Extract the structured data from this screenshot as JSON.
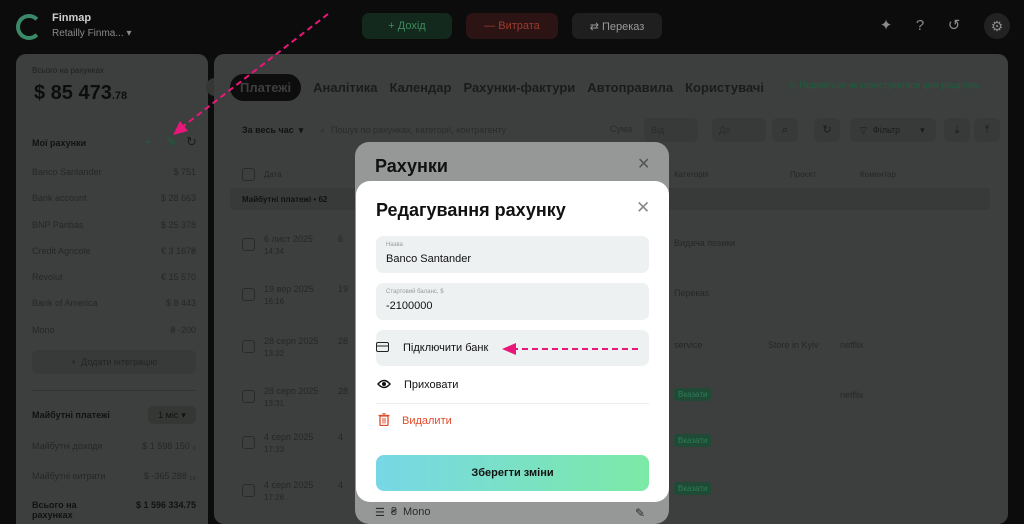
{
  "topbar": {
    "app_name": "Finmap",
    "workspace": "Retailly Finma...",
    "income_btn": "+ Дохід",
    "expense_btn": "— Витрата",
    "transfer_btn": "⇄ Переказ",
    "icons": [
      "sparkle-icon",
      "help-icon",
      "history-icon",
      "gear-icon"
    ]
  },
  "sidebar": {
    "total_label": "Всього на рахунках",
    "total_value": "$ 85 473",
    "total_cents": ".78",
    "my_accounts": "Мої рахунки",
    "accounts": [
      {
        "name": "Banco Santander",
        "balance": "$ 751"
      },
      {
        "name": "Bank account",
        "balance": "$ 28 663"
      },
      {
        "name": "BNP Paribas",
        "balance": "$ 25 378"
      },
      {
        "name": "Credit Agricole",
        "balance": "€ 3 167₴"
      },
      {
        "name": "Revolut",
        "balance": "€ 15 570"
      },
      {
        "name": "Bank of America",
        "balance": "$ 8 443"
      },
      {
        "name": "Mono",
        "balance": "₴ -200"
      }
    ],
    "add_integration": "Додати інтеграцію",
    "future_payments": "Майбутні платежі",
    "period": "1 міс",
    "future_income_label": "Майбутні доходи",
    "future_income_value": "$ 1 598 150 ₀",
    "future_expense_label": "Майбутні витрати",
    "future_expense_value": "$ -365 288 ₁₉",
    "total_accounts_label": "Всього на рахунках",
    "total_accounts_value": "$ 1 596 334.75"
  },
  "main": {
    "tabs": [
      "Платежі",
      "Аналітика",
      "Календар",
      "Рахунки-фактури",
      "Автоправила",
      "Користувачі"
    ],
    "watch_link": "Подивіться як користуватися цим розділом",
    "period_filter": "За весь час",
    "search_placeholder": "Пошук по рахунках, категорії, контрагенту",
    "sum_label": "Сума",
    "from_placeholder": "Від",
    "to_placeholder": "До",
    "filter_btn": "Фільтр",
    "columns": {
      "date": "Дата",
      "category": "Категорія",
      "project": "Проєкт",
      "comment": "Коментар"
    },
    "group_label": "Майбутні платежі • 62",
    "rows": [
      {
        "date": "6 лист 2025",
        "time": "14:34",
        "d3": "6",
        "category": "Видача позики",
        "project": "",
        "comment": ""
      },
      {
        "date": "19 вер 2025",
        "time": "16:16",
        "d3": "19",
        "category": "Перекаs",
        "project": "",
        "comment": ""
      },
      {
        "date": "28 серп 2025",
        "time": "13:32",
        "d3": "28",
        "category": "service",
        "project": "Store in Kyiv",
        "comment": "netflix"
      },
      {
        "date": "28 серп 2025",
        "time": "13:31",
        "d3": "28",
        "category": "Вказати",
        "project": "",
        "comment": "netflix"
      },
      {
        "date": "4 серп 2025",
        "time": "17:33",
        "d3": "4",
        "category": "Вказати",
        "project": "",
        "comment": ""
      },
      {
        "date": "4 серп 2025",
        "time": "17:26",
        "d3": "4",
        "category": "Вказати",
        "project": "",
        "comment": ""
      }
    ]
  },
  "accounts_modal": {
    "title": "Рахунки",
    "footer_account": "Mono"
  },
  "edit_modal": {
    "title": "Редагування рахунку",
    "name_label": "Назва",
    "name_value": "Banco Santander",
    "balance_label": "Стартовий баланс, $",
    "balance_value": "-2100000",
    "connect_bank": "Підключити банк",
    "hide": "Приховати",
    "delete": "Видалити",
    "save": "Зберегти зміни"
  },
  "colors": {
    "accent_gradient_start": "#78d7e6",
    "accent_gradient_end": "#7ceaa6",
    "delete_red": "#e24b2b",
    "arrow_pink": "#e8177a"
  }
}
